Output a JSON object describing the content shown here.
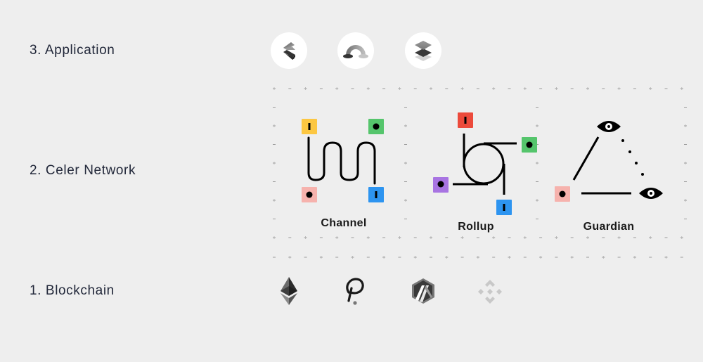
{
  "layers": [
    {
      "label": "3. Application"
    },
    {
      "label": "2. Celer Network"
    },
    {
      "label": "1. Blockchain"
    }
  ],
  "application_icons": [
    {
      "name": "celer-cbridge-icon"
    },
    {
      "name": "bridge-arc-icon"
    },
    {
      "name": "layers-stack-icon"
    }
  ],
  "celer_network": {
    "diagrams": [
      {
        "title": "Channel"
      },
      {
        "title": "Rollup"
      },
      {
        "title": "Guardian"
      }
    ],
    "node_colors": {
      "yellow": "#fcc742",
      "green": "#55c56c",
      "pink": "#f6b2ad",
      "blue": "#2d94f0",
      "red": "#ec4a3b",
      "purple": "#a874e2"
    }
  },
  "blockchain_icons": [
    {
      "name": "ethereum-icon"
    },
    {
      "name": "polkadot-icon"
    },
    {
      "name": "arbitrum-icon"
    },
    {
      "name": "binance-icon"
    }
  ]
}
